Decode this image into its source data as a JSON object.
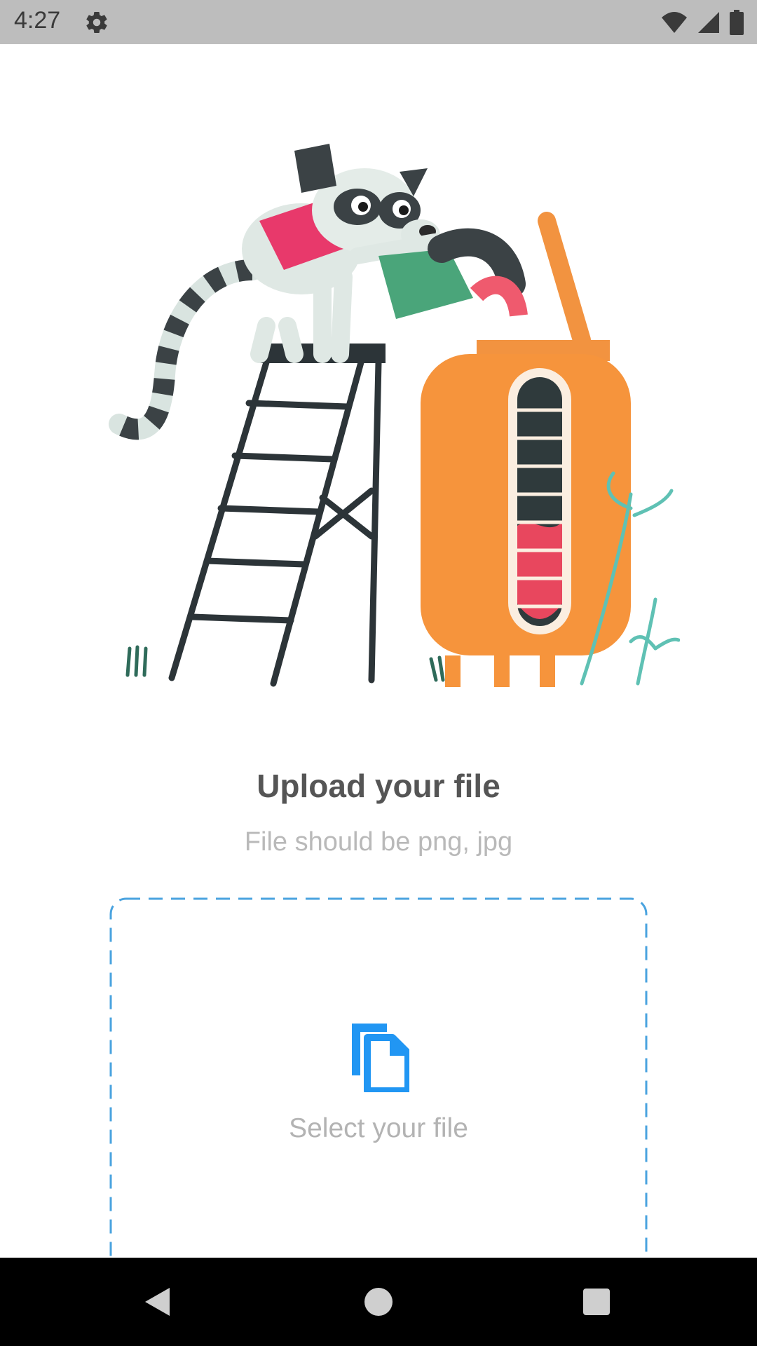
{
  "status_bar": {
    "time": "4:27",
    "icons": [
      "gear-icon",
      "wifi-icon",
      "signal-icon",
      "battery-icon"
    ]
  },
  "illustration": {
    "description_icon": "lemur-upload-illustration"
  },
  "upload": {
    "title": "Upload your file",
    "subtitle": "File should be png, jpg",
    "select_label": "Select your file",
    "icon": "file-copy-icon",
    "accent_color": "#2196f3",
    "border_color": "#4aa3df"
  },
  "nav_bar": {
    "buttons": [
      "back-icon",
      "home-icon",
      "recents-icon"
    ]
  }
}
